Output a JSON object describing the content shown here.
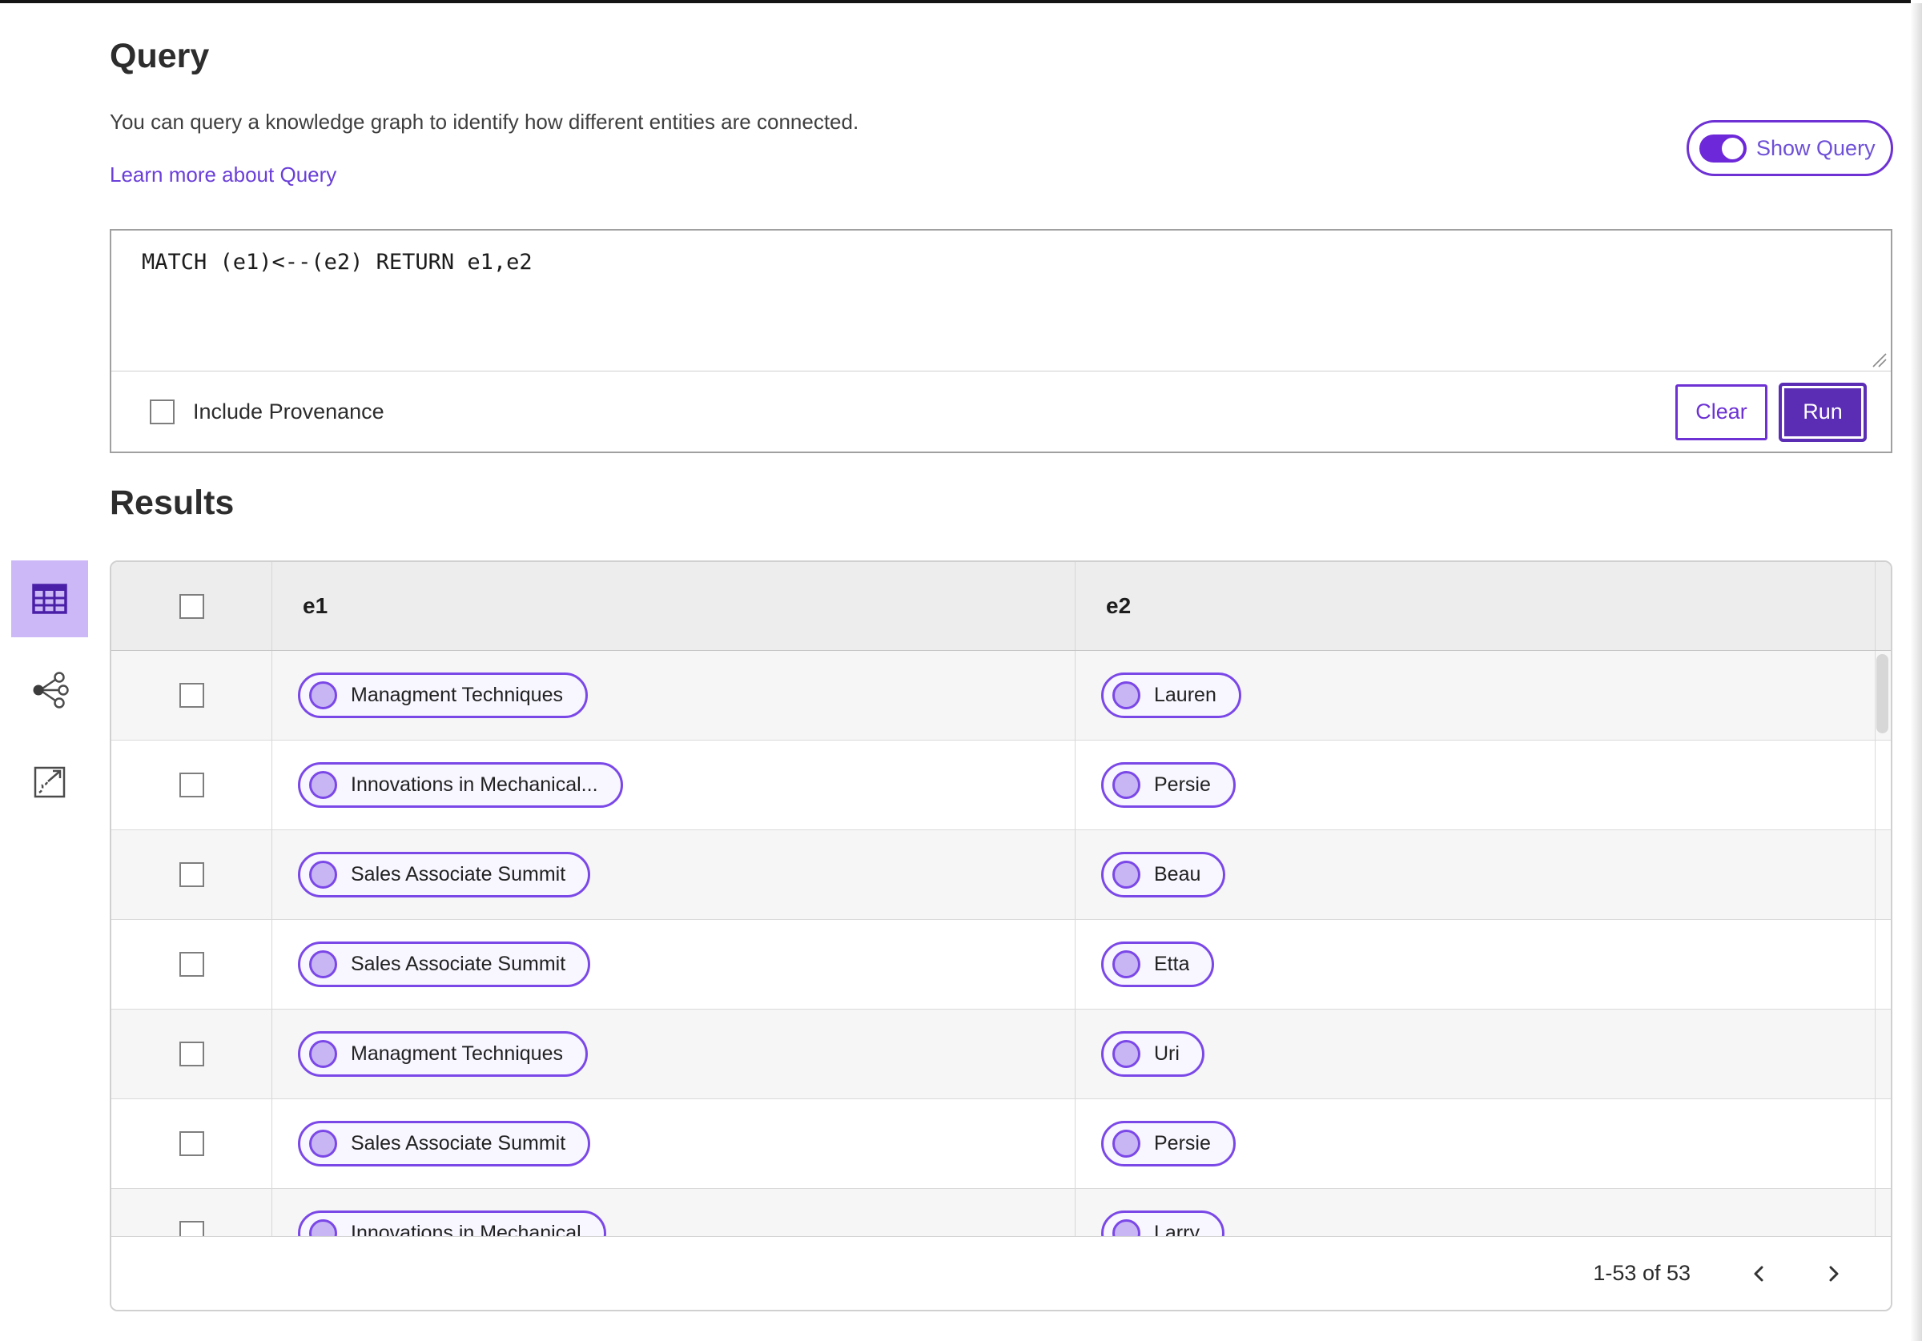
{
  "query_section": {
    "title": "Query",
    "description": "You can query a knowledge graph to identify how different entities are connected.",
    "learn_more_link": "Learn more about Query",
    "show_query_toggle": {
      "label": "Show Query",
      "state": "on"
    },
    "query_editor": {
      "value": "MATCH (e1)<--(e2) RETURN e1,e2"
    },
    "include_provenance": {
      "label": "Include Provenance",
      "checked": false
    },
    "buttons": {
      "clear": "Clear",
      "run": "Run"
    }
  },
  "results_section": {
    "title": "Results",
    "view_switch": {
      "icons": [
        "table-view-icon",
        "graph-view-icon",
        "expand-view-icon"
      ],
      "selected": "table-view-icon"
    },
    "table": {
      "columns": {
        "e1": "e1",
        "e2": "e2"
      },
      "select_all_checked": false,
      "rows": [
        {
          "e1": "Managment Techniques",
          "e2": "Lauren"
        },
        {
          "e1": "Innovations in Mechanical...",
          "e2": "Persie"
        },
        {
          "e1": "Sales Associate Summit",
          "e2": "Beau"
        },
        {
          "e1": "Sales Associate Summit",
          "e2": "Etta"
        },
        {
          "e1": "Managment Techniques",
          "e2": "Uri"
        },
        {
          "e1": "Sales Associate Summit",
          "e2": "Persie"
        },
        {
          "e1": "Innovations in Mechanical",
          "e2": "Larry"
        }
      ]
    },
    "pagination": {
      "range_text": "1-53 of 53"
    }
  },
  "colors": {
    "accent_purple": "#6d31d4",
    "run_button_fill": "#5b2db5",
    "pill_border": "#7b48e8",
    "pill_background": "#f8f6fe",
    "pill_dot_fill": "#c8b5f3",
    "selected_view_background": "#ccb8f7",
    "table_header_background": "#ededed",
    "row_stripe": "#f6f6f6"
  }
}
